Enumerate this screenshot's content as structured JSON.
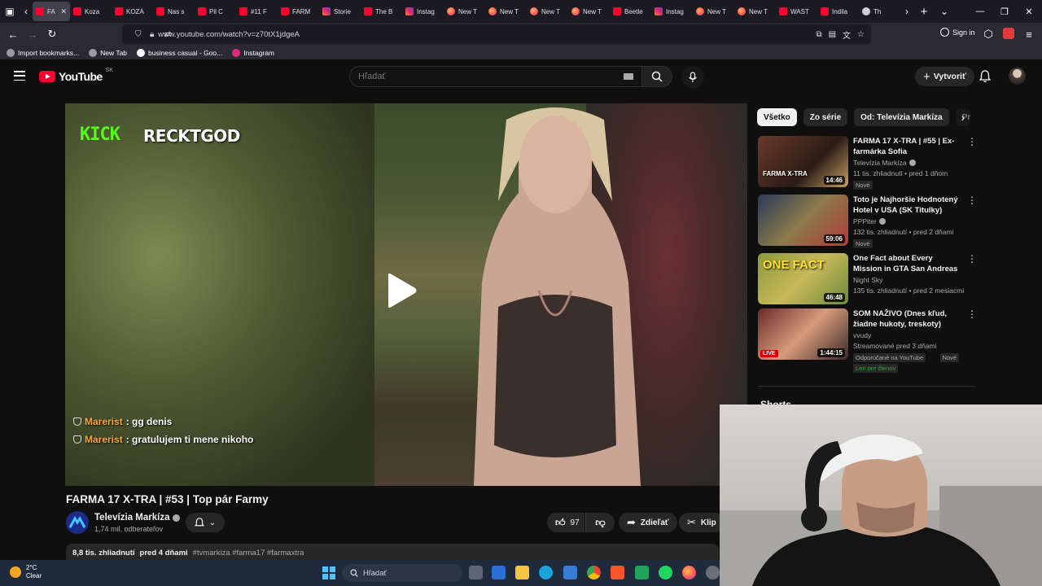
{
  "browser": {
    "tabs": [
      {
        "label": "FA",
        "favicon": "youtube-icon",
        "active": true
      },
      {
        "label": "Koza",
        "favicon": "youtube-icon"
      },
      {
        "label": "KOZA",
        "favicon": "youtube-icon"
      },
      {
        "label": "Nas s",
        "favicon": "youtube-icon"
      },
      {
        "label": "Pil C",
        "favicon": "youtube-icon"
      },
      {
        "label": "#11 F",
        "favicon": "youtube-icon"
      },
      {
        "label": "FARM",
        "favicon": "youtube-icon"
      },
      {
        "label": "Storie",
        "favicon": "instagram-icon"
      },
      {
        "label": "The B",
        "favicon": "youtube-icon"
      },
      {
        "label": "Instag",
        "favicon": "instagram-icon"
      },
      {
        "label": "New T",
        "favicon": "firefox-icon"
      },
      {
        "label": "New T",
        "favicon": "firefox-icon"
      },
      {
        "label": "New T",
        "favicon": "firefox-icon"
      },
      {
        "label": "New T",
        "favicon": "firefox-icon"
      },
      {
        "label": "Beetle",
        "favicon": "youtube-icon"
      },
      {
        "label": "Instag",
        "favicon": "instagram-icon"
      },
      {
        "label": "New T",
        "favicon": "firefox-icon"
      },
      {
        "label": "New T",
        "favicon": "firefox-icon"
      },
      {
        "label": "WAST",
        "favicon": "youtube-icon"
      },
      {
        "label": "Indila",
        "favicon": "youtube-icon"
      },
      {
        "label": "Th",
        "favicon": "generic-icon"
      }
    ],
    "url": "www.youtube.com/watch?v=z70tX1jdgeA",
    "sign_in": "Sign in",
    "bookmarks": [
      {
        "label": "Import bookmarks...",
        "icon": "import-icon"
      },
      {
        "label": "New Tab",
        "icon": "globe-icon"
      },
      {
        "label": "business casual - Goo...",
        "icon": "google-icon"
      },
      {
        "label": "Instagram",
        "icon": "instagram-icon"
      }
    ]
  },
  "youtube": {
    "logo_text": "YouTube",
    "country": "SK",
    "search_placeholder": "Hľadať",
    "create_label": "Vytvoriť"
  },
  "player": {
    "stream_brand": "KICK",
    "stream_channel": "RECKTGOD",
    "chat": [
      {
        "user": "Marerist",
        "message": ": gg denis"
      },
      {
        "user": "Marerist",
        "message": ": gratulujem ti mene nikoho"
      }
    ]
  },
  "video": {
    "title": "FARMA 17 X-TRA | #53 | Top pár Farmy",
    "channel": "Televízia Markíza",
    "subscribers": "1,74 mil. odberateľov",
    "likes": "97",
    "share_label": "Zdieľať",
    "clip_label": "Klip",
    "views": "8,8 tis. zhliadnutí",
    "posted": "pred 4 dňami",
    "tags": "#tvmarkiza #farma17 #farmaxtra"
  },
  "sidebar": {
    "chips": [
      "Všetko",
      "Zo série",
      "Od: Televízia Markíza",
      "Pr"
    ],
    "recommendations": [
      {
        "title": "FARMA 17 X-TRA | #55 | Ex-farmárka Sofia",
        "channel": "Televízia Markíza",
        "verified": true,
        "meta": "11 tis. zhliadnutí • pred 1 dňom",
        "badges": [
          "Nové"
        ],
        "duration": "14:46",
        "thumb_text": "FARMA X-TRA"
      },
      {
        "title": "Toto je Najhoršie Hodnotený Hotel v USA (SK Titulky)",
        "channel": "PPPiter",
        "verified": true,
        "meta": "132 tis. zhliadnutí • pred 2 dňami",
        "badges": [
          "Nové"
        ],
        "duration": "59:06"
      },
      {
        "title": "One Fact about Every Mission in GTA San Andreas",
        "channel": "Night Sky",
        "verified": false,
        "meta": "135 tis. zhliadnutí • pred 2 mesiacmi",
        "badges": [],
        "duration": "46:48",
        "thumb_text": "ONE FACT"
      },
      {
        "title": "SOM NAŽIVO (Dnes kľud, žiadne hukoty, treskoty)",
        "channel": "vvudy",
        "verified": false,
        "meta": "Streamované pred 3 dňami",
        "badges": [
          "Odporúčané na YouTube",
          "Nové"
        ],
        "members_label": "Len pre členov",
        "duration": "1:44:15",
        "live_label": "LIVE"
      }
    ],
    "shorts_label": "Shorts"
  },
  "taskbar": {
    "temperature": "2°C",
    "condition": "Clear",
    "search_label": "Hľadať"
  },
  "colors": {
    "yt_red": "#ff0033",
    "kick_green": "#53fc18",
    "chat_user": "#f7a53b",
    "members_green": "#2ba640"
  }
}
